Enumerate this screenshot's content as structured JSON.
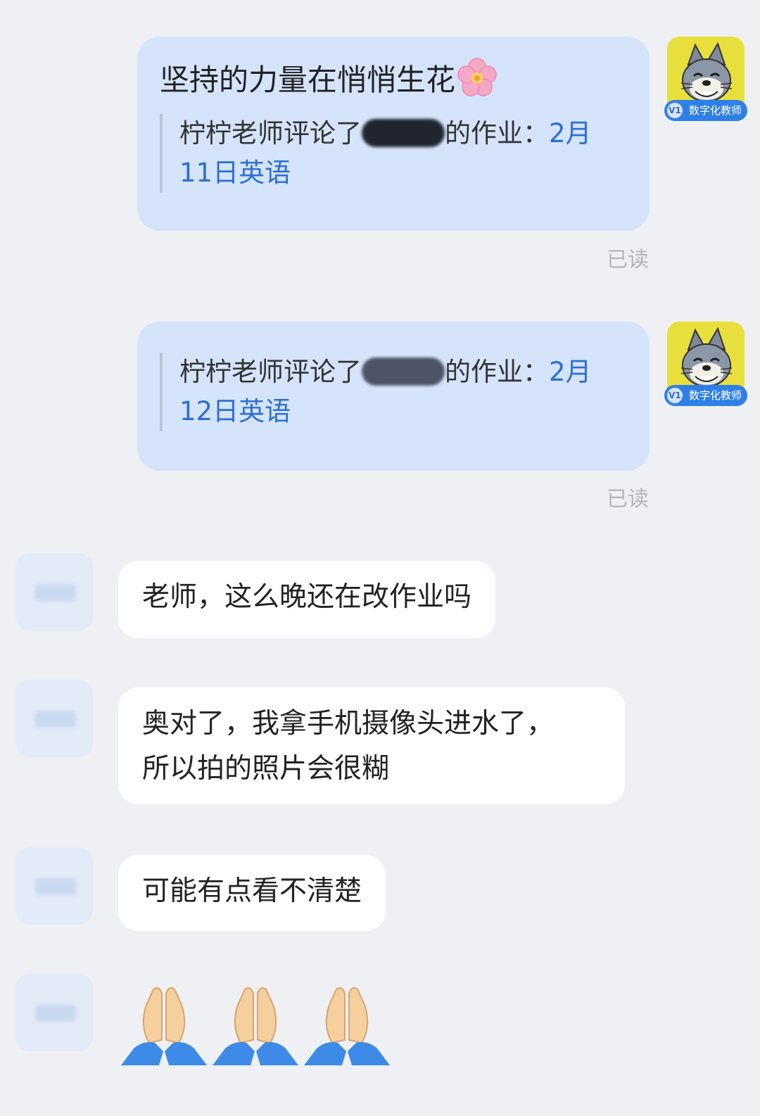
{
  "messages": [
    {
      "side": "right",
      "avatar_badge": "数字化教师",
      "avatar_level": "V1",
      "title": "坚持的力量在悄悄生花",
      "comment_prefix": "柠柠老师评论了",
      "comment_suffix": "的作业：",
      "link_text_1": "2月",
      "link_text_2": "11日英语",
      "status": "已读"
    },
    {
      "side": "right",
      "avatar_badge": "数字化教师",
      "avatar_level": "V1",
      "comment_prefix": "柠柠老师评论了",
      "comment_suffix": "的作业：",
      "link_text_1": "2月",
      "link_text_2": "12日英语",
      "status": "已读"
    },
    {
      "side": "left",
      "text": "老师，这么晚还在改作业吗"
    },
    {
      "side": "left",
      "line1": "奥对了，我拿手机摄像头进水了，",
      "line2": "所以拍的照片会很糊"
    },
    {
      "side": "left",
      "text": "可能有点看不清楚"
    },
    {
      "side": "left",
      "emoji": "folded-hands",
      "count": 3
    }
  ],
  "colors": {
    "background": "#eef0f4",
    "bubble_blue": "#d5e4fb",
    "bubble_white": "#ffffff",
    "link": "#2d6fd0",
    "badge": "#2f80e6",
    "avatar_yellow": "#e9df3c",
    "read_status": "#b2b6bd"
  }
}
